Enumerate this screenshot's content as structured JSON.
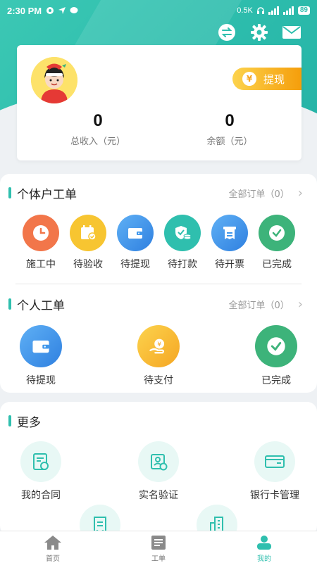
{
  "status_bar": {
    "time": "2:30 PM",
    "network_speed": "0.5K",
    "battery": "89"
  },
  "colors": {
    "primary": "#2fbfae",
    "withdraw_gradient": [
      "#fcd34d",
      "#f59e0b"
    ]
  },
  "header_icons": [
    "switch-icon",
    "gear-icon",
    "mail-icon"
  ],
  "profile": {
    "withdraw_label": "提现",
    "withdraw_symbol": "¥",
    "total_income_value": "0",
    "total_income_label": "总收入（元）",
    "balance_value": "0",
    "balance_label": "余额（元）"
  },
  "individual_orders": {
    "title": "个体户工单",
    "all_orders": "全部订单（0）",
    "items": [
      {
        "label": "施工中",
        "icon": "clock-icon",
        "color": "#f2764a"
      },
      {
        "label": "待验收",
        "icon": "calendar-check-icon",
        "color": "#f7c531"
      },
      {
        "label": "待提现",
        "icon": "wallet-icon",
        "color": "#3f97ec"
      },
      {
        "label": "待打款",
        "icon": "shield-coins-icon",
        "color": "#2fbfae"
      },
      {
        "label": "待开票",
        "icon": "invoice-icon",
        "color": "#3f97ec"
      },
      {
        "label": "已完成",
        "icon": "check-icon",
        "color": "#3db37a"
      }
    ]
  },
  "personal_orders": {
    "title": "个人工单",
    "all_orders": "全部订单（0）",
    "items": [
      {
        "label": "待提现",
        "icon": "wallet-icon",
        "color": "#3f97ec"
      },
      {
        "label": "待支付",
        "icon": "coin-hand-icon",
        "color": "#f7c531"
      },
      {
        "label": "已完成",
        "icon": "check-icon",
        "color": "#3db37a"
      }
    ]
  },
  "more": {
    "title": "更多",
    "items": [
      {
        "label": "我的合同",
        "icon": "contract-icon"
      },
      {
        "label": "实名验证",
        "icon": "id-card-icon"
      },
      {
        "label": "银行卡管理",
        "icon": "bank-card-icon"
      },
      {
        "label": "",
        "icon": "receipt-icon"
      },
      {
        "label": "",
        "icon": "building-icon"
      }
    ]
  },
  "bottom_nav": [
    {
      "label": "首页",
      "icon": "home-icon",
      "active": false
    },
    {
      "label": "工单",
      "icon": "orders-icon",
      "active": false
    },
    {
      "label": "我的",
      "icon": "user-icon",
      "active": true
    }
  ]
}
